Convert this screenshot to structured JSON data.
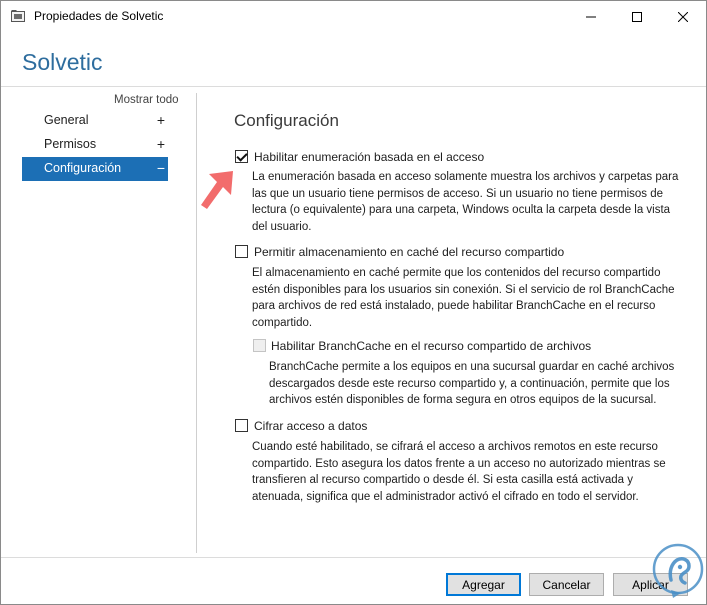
{
  "window": {
    "title": "Propiedades de Solvetic",
    "icon": "folder-share-icon"
  },
  "header": {
    "title": "Solvetic"
  },
  "sidebar": {
    "show_all": "Mostrar todo",
    "items": [
      {
        "label": "General",
        "sign": "+"
      },
      {
        "label": "Permisos",
        "sign": "+"
      },
      {
        "label": "Configuración",
        "sign": "−",
        "active": true
      }
    ]
  },
  "content": {
    "section_title": "Configuración",
    "options": [
      {
        "label": "Habilitar enumeración basada en el acceso",
        "checked": true,
        "enabled": true,
        "description": [
          "La enumeración basada en acceso solamente muestra los archivos y carpetas para",
          "las que un usuario tiene permisos de acceso. Si un usuario no tiene permisos de",
          "lectura (o equivalente) para una carpeta, Windows oculta la carpeta desde la vista",
          "del usuario."
        ]
      },
      {
        "label": "Permitir almacenamiento en caché del recurso compartido",
        "checked": false,
        "enabled": true,
        "description": [
          "El almacenamiento en caché permite que los contenidos del recurso compartido",
          "estén disponibles para los usuarios sin conexión. Si el servicio de rol BranchCache",
          "para archivos de red está instalado, puede habilitar BranchCache en el recurso",
          "compartido."
        ]
      },
      {
        "label": "Habilitar BranchCache en el recurso compartido de archivos",
        "checked": false,
        "enabled": false,
        "description": [
          "BranchCache permite a los equipos en una sucursal guardar en caché archivos",
          "descargados desde este recurso compartido y, a continuación, permite que los",
          "archivos estén disponibles de forma segura en otros equipos de la sucursal."
        ]
      },
      {
        "label": "Cifrar acceso a datos",
        "checked": false,
        "enabled": true,
        "description": [
          "Cuando esté habilitado, se cifrará el acceso a archivos remotos en este recurso",
          "compartido. Esto asegura los datos frente a un acceso no autorizado mientras se",
          "transfieren al recurso compartido o desde él. Si esta casilla está activada y",
          "atenuada, significa que el administrador activó el cifrado en todo el servidor."
        ]
      }
    ]
  },
  "footer": {
    "add_label": "Agregar",
    "cancel_label": "Cancelar",
    "apply_label": "Aplicar"
  },
  "colors": {
    "accent": "#1c6fb5",
    "header_text": "#2e6d9e",
    "arrow": "#f26c6c",
    "watermark": "#4a8fc7"
  }
}
